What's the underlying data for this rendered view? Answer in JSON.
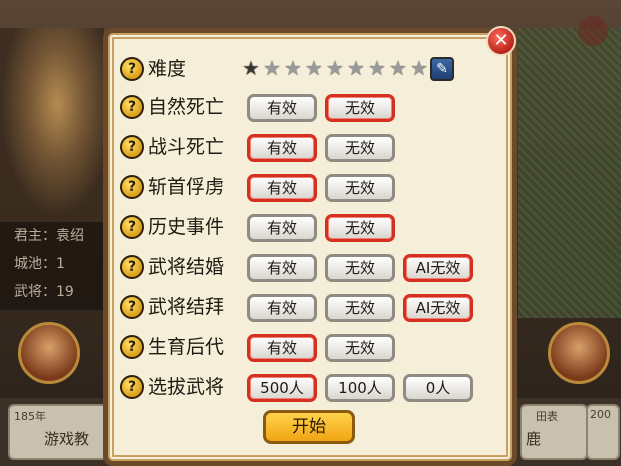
{
  "background": {
    "info": [
      "君主：袁绍",
      "城池：1",
      "武将：19"
    ],
    "bottom_year": "185年",
    "bottom_text": "游戏教",
    "bottom_right_small": "田表",
    "bottom_right_year": "200",
    "bottom_right_text": "鹿"
  },
  "dialog": {
    "close_glyph": "✕",
    "difficulty": {
      "label": "难度",
      "stars_total": 9,
      "stars_level": 0.5,
      "edit_glyph": "✎"
    },
    "rows": [
      {
        "label": "自然死亡",
        "options": [
          "有效",
          "无效"
        ],
        "selected": 1
      },
      {
        "label": "战斗死亡",
        "options": [
          "有效",
          "无效"
        ],
        "selected": 0
      },
      {
        "label": "斩首俘虏",
        "options": [
          "有效",
          "无效"
        ],
        "selected": 0
      },
      {
        "label": "历史事件",
        "options": [
          "有效",
          "无效"
        ],
        "selected": 1
      },
      {
        "label": "武将结婚",
        "options": [
          "有效",
          "无效",
          "AI无效"
        ],
        "selected": 2
      },
      {
        "label": "武将结拜",
        "options": [
          "有效",
          "无效",
          "AI无效"
        ],
        "selected": 2
      },
      {
        "label": "生育后代",
        "options": [
          "有效",
          "无效"
        ],
        "selected": 0
      },
      {
        "label": "选拔武将",
        "options": [
          "500人",
          "100人",
          "0人"
        ],
        "selected": 0
      }
    ],
    "start_label": "开始"
  },
  "icons": {
    "question": "?",
    "star": "★"
  },
  "colors": {
    "selected_border": "#d5301f",
    "star_on": "#f0b21a",
    "star_off": "#9a9a9a"
  }
}
